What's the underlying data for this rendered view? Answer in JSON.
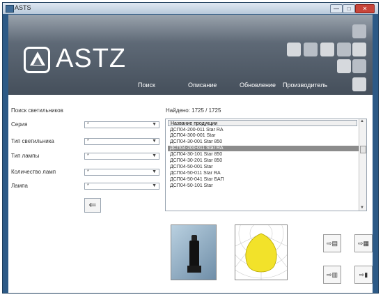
{
  "window": {
    "title": "ASTS",
    "minimize": "—",
    "maximize": "□",
    "close": "✕"
  },
  "header": {
    "logo_text": "ASTZ",
    "nav": {
      "search": "Поиск",
      "description": "Описание",
      "update": "Обновление",
      "manufacturer": "Производитель"
    }
  },
  "filters": {
    "section_title": "Поиск светильников",
    "rows": [
      {
        "label": "Серия",
        "value": "*"
      },
      {
        "label": "Тип светильника",
        "value": "*"
      },
      {
        "label": "Тип лампы",
        "value": "*"
      },
      {
        "label": "Количество ламп",
        "value": "*"
      },
      {
        "label": "Лампа",
        "value": "*"
      }
    ]
  },
  "results": {
    "found": "Найдено: 1725 / 1725",
    "column_header": "Название продукции",
    "items": [
      "ДСП04-200-011 Star RA",
      "ДСП04-300-001 Star",
      "ДСП04-30-001 Star 850",
      "ДСП04-200-011 Star RA",
      "ДСП04-30-101 Star 850",
      "ДСП04-30-201 Star 850",
      "ДСП04-50-001 Star",
      "ДСП04-50-011 Star RA",
      "ДСП04-50-041 Star БАП",
      "ДСП04-50-101 Star"
    ],
    "selected_index": 3
  },
  "icons": {
    "back": "back-arrow-icon",
    "export_doc": "export-doc-icon",
    "export_table": "export-table-icon",
    "export_pdf": "export-pdf-icon",
    "exit": "exit-door-icon"
  },
  "colors": {
    "frame": "#2d5a86",
    "header_top": "#9aa3ad",
    "header_bottom": "#454f5b",
    "selected_row": "#8c8c8c",
    "polar_fill": "#f2e22a"
  }
}
